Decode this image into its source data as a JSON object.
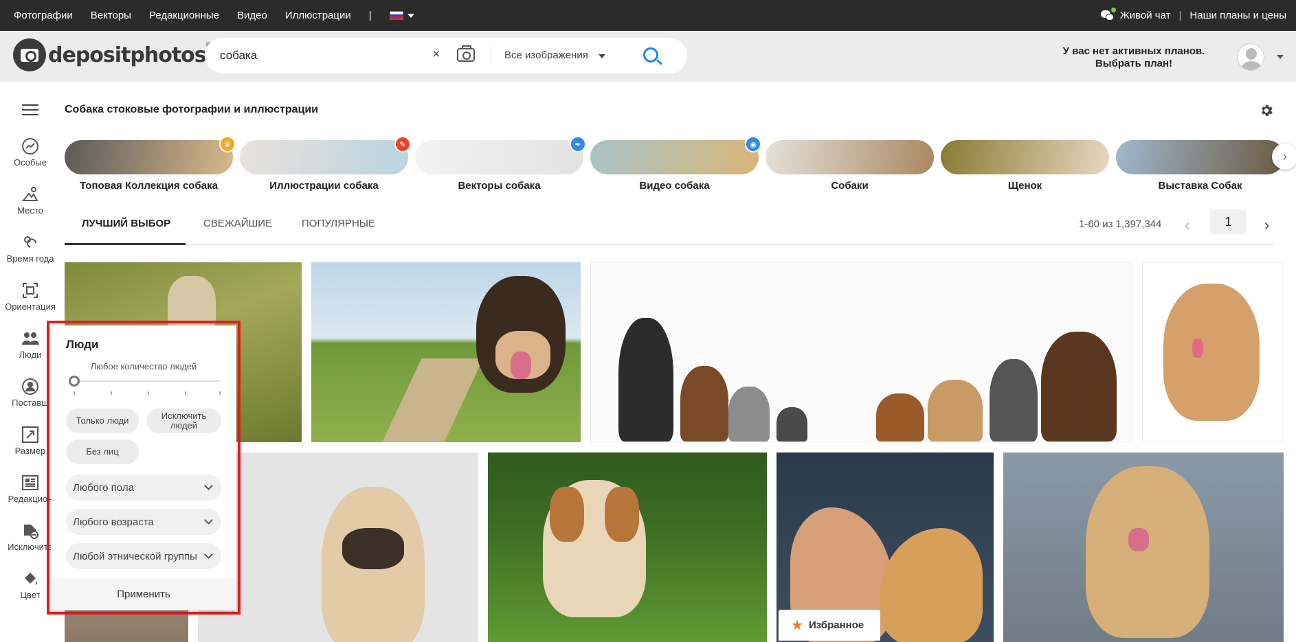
{
  "topbar": {
    "nav": [
      "Фотографии",
      "Векторы",
      "Редакционные",
      "Видео",
      "Иллюстрации"
    ],
    "separator": "|",
    "live_chat": "Живой чат",
    "divider": "|",
    "plans_link": "Наши планы и цены",
    "flag_colors": [
      "#ffffff",
      "#1c3fd6",
      "#d8232a"
    ]
  },
  "header": {
    "logo_text": "depositphotos",
    "logo_mark": "®",
    "search_value": "собака",
    "clear_icon": "×",
    "filter_selected": "Все изображения",
    "plans_line1": "У вас нет активных планов.",
    "plans_line2": "Выбрать план!"
  },
  "sidebar": {
    "items": [
      {
        "label": "Особые",
        "icon": "trend-icon"
      },
      {
        "label": "Место",
        "icon": "place-icon"
      },
      {
        "label": "Время года",
        "icon": "season-icon"
      },
      {
        "label": "Ориентация",
        "icon": "orientation-icon"
      },
      {
        "label": "Люди",
        "icon": "people-icon"
      },
      {
        "label": "Поставщ",
        "icon": "contributor-icon"
      },
      {
        "label": "Размер",
        "icon": "size-icon"
      },
      {
        "label": "Редакцион",
        "icon": "editorial-icon"
      },
      {
        "label": "Исключите",
        "icon": "exclude-icon"
      },
      {
        "label": "Цвет",
        "icon": "color-icon"
      }
    ]
  },
  "main": {
    "title": "Собака стоковые фотографии и иллюстрации",
    "categories": [
      {
        "label": "Топовая Коллекция собака",
        "badge_color": "#f5a623",
        "badge_icon": "crown-icon",
        "c1": "#5a5a5a",
        "c2": "#d9b88a"
      },
      {
        "label": "Иллюстрации собака",
        "badge_color": "#e8452c",
        "badge_icon": "brush-icon",
        "c1": "#e9e2dc",
        "c2": "#b8d4e0"
      },
      {
        "label": "Векторы собака",
        "badge_color": "#2e8be6",
        "badge_icon": "pen-icon",
        "c1": "#f2f2f2",
        "c2": "#e2e2e2"
      },
      {
        "label": "Видео собака",
        "badge_color": "#2e8be6",
        "badge_icon": "camera-icon",
        "c1": "#a9c3c8",
        "c2": "#d8b677"
      },
      {
        "label": "Собаки",
        "badge_color": "",
        "badge_icon": "",
        "c1": "#e6e1db",
        "c2": "#a88860"
      },
      {
        "label": "Щенок",
        "badge_color": "",
        "badge_icon": "",
        "c1": "#8a7a33",
        "c2": "#e8d7c0"
      },
      {
        "label": "Выставка Собак",
        "badge_color": "",
        "badge_icon": "",
        "c1": "#9fb8d0",
        "c2": "#6b5a40"
      }
    ],
    "tabs": [
      "ЛУЧШИЙ ВЫБОР",
      "СВЕЖАЙШИЕ",
      "ПОПУЛЯРНЫЕ"
    ],
    "result_count": "1-60 из 1,397,344",
    "page": "1",
    "favorite_label": "Избранное"
  },
  "people_filter": {
    "title": "Люди",
    "slider_label": "Любое количество людей",
    "chip_only_people": "Только люди",
    "chip_exclude_line1": "Исключить",
    "chip_exclude_line2": "людей",
    "chip_no_faces": "Без лиц",
    "gender": "Любого пола",
    "age": "Любого возраста",
    "ethnicity": "Любой этнической группы",
    "apply": "Применить"
  }
}
